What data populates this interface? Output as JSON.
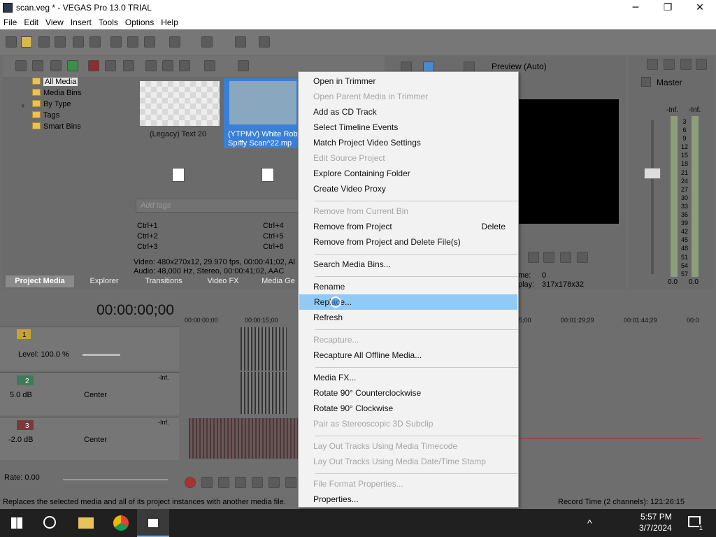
{
  "window": {
    "title": "scan.veg * - VEGAS Pro 13.0 TRIAL",
    "min": "─",
    "max": "❐",
    "close": "✕"
  },
  "menu": [
    "File",
    "Edit",
    "View",
    "Insert",
    "Tools",
    "Options",
    "Help"
  ],
  "media_tree": [
    "All Media",
    "Media Bins",
    "By Type",
    "Tags",
    "Smart Bins"
  ],
  "tree_expander": "+",
  "media_items": [
    {
      "label": "(Legacy) Text 20"
    },
    {
      "label": "(YTPMV) White Robi Spiffy Scan^22.mp"
    }
  ],
  "tags_placeholder": "Add tags",
  "shortcuts": [
    "Ctrl+1",
    "Ctrl+2",
    "Ctrl+3",
    "Ctrl+4",
    "Ctrl+5",
    "Ctrl+6"
  ],
  "media_info": {
    "video": "Video: 480x270x12, 29.970 fps, 00:00:41;02, Al",
    "audio": "Audio: 48,000 Hz, Stereo, 00:00:41;02, AAC"
  },
  "window_tabs": [
    "Project Media",
    "Explorer",
    "Transitions",
    "Video FX",
    "Media Ge"
  ],
  "preview": {
    "mode": "Preview (Auto)",
    "frame_label": "me:",
    "frame_value": "0",
    "display_label": "play:",
    "display_value": "317x178x32"
  },
  "master": {
    "label": "Master",
    "inf_left": "-Inf.",
    "inf_right": "-Inf.",
    "scale": [
      "3",
      "6",
      "9",
      "12",
      "15",
      "18",
      "21",
      "24",
      "27",
      "30",
      "33",
      "36",
      "39",
      "42",
      "45",
      "48",
      "51",
      "54",
      "57"
    ],
    "bottom_left": "0.0",
    "bottom_right": "0.0"
  },
  "timecode": "00:00:00;00",
  "ruler": [
    "00:00:00;00",
    "00:00:15;00",
    "5;00",
    "00:01:29;29",
    "00:01:44;29",
    "00:0"
  ],
  "tracks": [
    {
      "num": "1",
      "level": "Level: 100.0 %"
    },
    {
      "num": "2",
      "vol": "5.0 dB",
      "pan": "Center",
      "inf": "-Inf."
    },
    {
      "num": "3",
      "vol": "-2.0 dB",
      "pan": "Center",
      "inf": "-Inf."
    }
  ],
  "meter_marks": [
    "12",
    "24",
    "36",
    "48"
  ],
  "rate": "Rate: 0.00",
  "status_text": "Replaces the selected media and all of its project instances with another media file.",
  "record_time": "Record Time (2 channels): 121:26:15",
  "context_menu": [
    {
      "label": "Open in Trimmer",
      "disabled": false
    },
    {
      "label": "Open Parent Media in Trimmer",
      "disabled": true
    },
    {
      "label": "Add as CD Track",
      "disabled": false
    },
    {
      "label": "Select Timeline Events",
      "disabled": false
    },
    {
      "label": "Match Project Video Settings",
      "disabled": false
    },
    {
      "label": "Edit Source Project",
      "disabled": true
    },
    {
      "label": "Explore Containing Folder",
      "disabled": false
    },
    {
      "label": "Create Video Proxy",
      "disabled": false
    },
    {
      "label": "Remove from Current Bin",
      "disabled": true
    },
    {
      "label": "Remove from Project",
      "disabled": false,
      "shortcut": "Delete"
    },
    {
      "label": "Remove from Project and Delete File(s)",
      "disabled": false
    },
    {
      "label": "Search Media Bins...",
      "disabled": false
    },
    {
      "label": "Rename",
      "disabled": false
    },
    {
      "label": "Replace...",
      "disabled": false,
      "highlighted": true
    },
    {
      "label": "Refresh",
      "disabled": false
    },
    {
      "label": "Recapture...",
      "disabled": true
    },
    {
      "label": "Recapture All Offline Media...",
      "disabled": false
    },
    {
      "label": "Media FX...",
      "disabled": false
    },
    {
      "label": "Rotate 90° Counterclockwise",
      "disabled": false
    },
    {
      "label": "Rotate 90° Clockwise",
      "disabled": false
    },
    {
      "label": "Pair as Stereoscopic 3D Subclip",
      "disabled": true
    },
    {
      "label": "Lay Out Tracks Using Media Timecode",
      "disabled": true
    },
    {
      "label": "Lay Out Tracks Using Media Date/Time Stamp",
      "disabled": true
    },
    {
      "label": "File Format Properties...",
      "disabled": true
    },
    {
      "label": "Properties...",
      "disabled": false
    }
  ],
  "taskbar": {
    "time": "5:57 PM",
    "date": "3/7/2024",
    "notif_count": "1"
  },
  "colors": {
    "highlight": "#91c9f7",
    "panel": "#6b6b6b",
    "taskbar": "#202020"
  }
}
